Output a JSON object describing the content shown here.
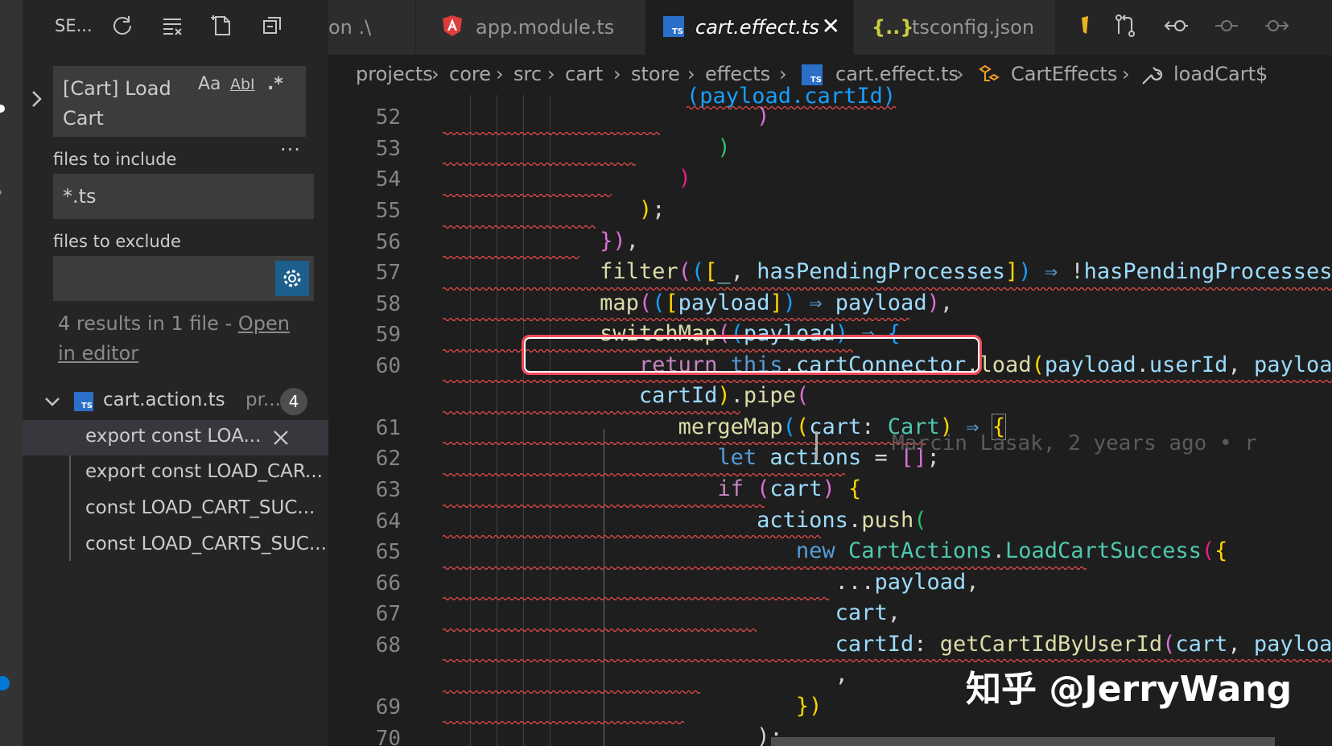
{
  "sidebar": {
    "title": "SE...",
    "search": {
      "query": "[Cart] Load Cart",
      "match_case": "Aa",
      "whole_word": "AbI",
      "regex": ".*"
    },
    "include_label": "files to include",
    "include_value": "*.ts",
    "exclude_label": "files to exclude",
    "exclude_value": "",
    "more": "···",
    "results_prefix": "4 results in 1 file - ",
    "results_link": "Open in editor",
    "file": {
      "icon": "TS",
      "name": "cart.action.ts",
      "path": "pr...",
      "count": "4"
    },
    "matches": [
      "export const LOA...",
      "export const LOAD_CAR...",
      "const LOAD_CART_SUC...",
      "const LOAD_CARTS_SUC..."
    ]
  },
  "tabs": [
    {
      "label": "on .\\",
      "active": false
    },
    {
      "label": "app.module.ts",
      "icon": "angular-icon",
      "active": false
    },
    {
      "label": "cart.effect.ts",
      "icon": "TS",
      "active": true,
      "close": "✕"
    },
    {
      "label": "tsconfig.json",
      "icon": "{..}",
      "active": false
    }
  ],
  "breadcrumbs": [
    "projects",
    "core",
    "src",
    "cart",
    "store",
    "effects",
    "cart.effect.ts",
    "CartEffects",
    "loadCart$"
  ],
  "code": {
    "line_numbers": [
      "52",
      "53",
      "54",
      "55",
      "56",
      "57",
      "58",
      "59",
      "60",
      "",
      "61",
      "62",
      "63",
      "64",
      "65",
      "66",
      "67",
      "68",
      "",
      "69",
      "70"
    ],
    "partial_top": "(payload.cartId)",
    "blame": "Marcin Lasak, 2 years ago • r"
  },
  "watermark": "知乎 @JerryWang"
}
